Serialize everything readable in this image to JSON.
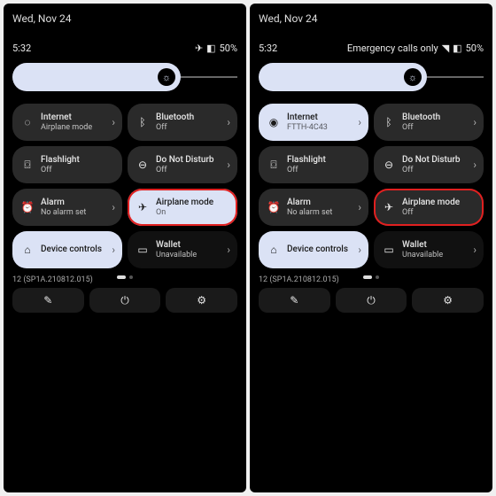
{
  "left": {
    "date": "Wed, Nov 24",
    "time": "5:32",
    "status_extra": "",
    "battery": "50%",
    "tiles": [
      {
        "name": "internet",
        "title": "Internet",
        "sub": "Airplane mode",
        "icon": "◌",
        "on": false,
        "chev": true
      },
      {
        "name": "bluetooth",
        "title": "Bluetooth",
        "sub": "Off",
        "icon": "ᛒ",
        "on": false,
        "chev": true
      },
      {
        "name": "flashlight",
        "title": "Flashlight",
        "sub": "Off",
        "icon": "⌼",
        "on": false,
        "chev": false
      },
      {
        "name": "dnd",
        "title": "Do Not Disturb",
        "sub": "Off",
        "icon": "⊖",
        "on": false,
        "chev": true
      },
      {
        "name": "alarm",
        "title": "Alarm",
        "sub": "No alarm set",
        "icon": "⏰",
        "on": false,
        "chev": true
      },
      {
        "name": "airplane",
        "title": "Airplane mode",
        "sub": "On",
        "icon": "✈",
        "on": true,
        "chev": false,
        "highlight": true
      },
      {
        "name": "devcontrols",
        "title": "Device controls",
        "sub": "",
        "icon": "⌂",
        "on": true,
        "chev": true
      },
      {
        "name": "wallet",
        "title": "Wallet",
        "sub": "Unavailable",
        "icon": "▭",
        "on": false,
        "dim": true,
        "chev": true
      }
    ],
    "build": "12 (SP1A.210812.015)"
  },
  "right": {
    "date": "Wed, Nov 24",
    "time": "5:32",
    "status_extra": "Emergency calls only",
    "battery": "50%",
    "tiles": [
      {
        "name": "internet",
        "title": "Internet",
        "sub": "FTTH-4C43",
        "icon": "◉",
        "on": true,
        "chev": true
      },
      {
        "name": "bluetooth",
        "title": "Bluetooth",
        "sub": "Off",
        "icon": "ᛒ",
        "on": false,
        "chev": true
      },
      {
        "name": "flashlight",
        "title": "Flashlight",
        "sub": "Off",
        "icon": "⌼",
        "on": false,
        "chev": false
      },
      {
        "name": "dnd",
        "title": "Do Not Disturb",
        "sub": "Off",
        "icon": "⊖",
        "on": false,
        "chev": true
      },
      {
        "name": "alarm",
        "title": "Alarm",
        "sub": "No alarm set",
        "icon": "⏰",
        "on": false,
        "chev": true
      },
      {
        "name": "airplane",
        "title": "Airplane mode",
        "sub": "Off",
        "icon": "✈",
        "on": false,
        "chev": false,
        "highlight": true
      },
      {
        "name": "devcontrols",
        "title": "Device controls",
        "sub": "",
        "icon": "⌂",
        "on": true,
        "chev": true
      },
      {
        "name": "wallet",
        "title": "Wallet",
        "sub": "Unavailable",
        "icon": "▭",
        "on": false,
        "dim": true,
        "chev": true
      }
    ],
    "build": "12 (SP1A.210812.015)"
  },
  "icons": {
    "edit": "✎",
    "power": "⏻",
    "gear": "⚙",
    "brightness": "☼",
    "plane": "✈",
    "wifi": "◥",
    "batt": "◧"
  }
}
